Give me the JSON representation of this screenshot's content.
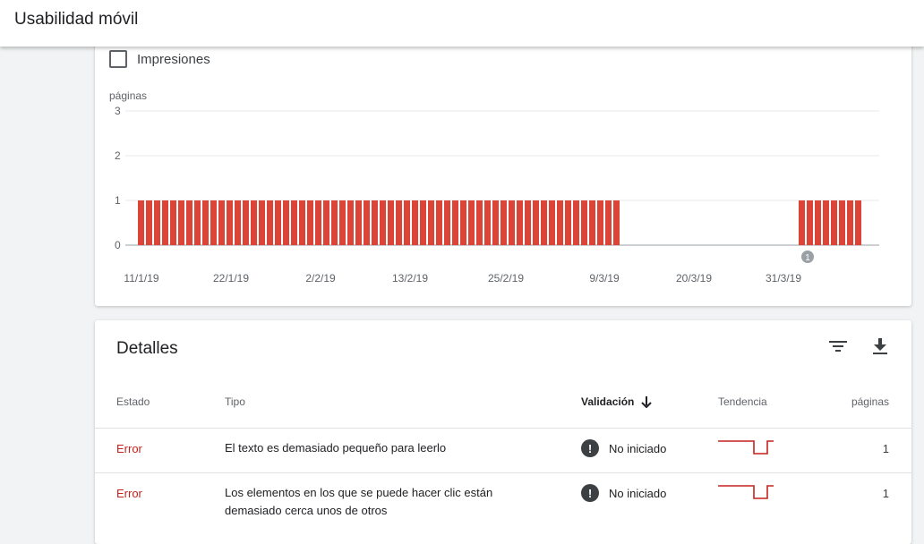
{
  "header": {
    "title": "Usabilidad móvil"
  },
  "chart_controls": {
    "impressions_label": "Impresiones"
  },
  "chart_data": {
    "type": "bar",
    "ylabel": "páginas",
    "ylim": [
      0,
      3
    ],
    "yticks": [
      "0",
      "1",
      "2",
      "3"
    ],
    "x_tick_labels": [
      "11/1/19",
      "22/1/19",
      "2/2/19",
      "13/2/19",
      "25/2/19",
      "9/3/19",
      "20/3/19",
      "31/3/19"
    ],
    "annotation": {
      "label": "1",
      "date": "1/4/19"
    },
    "bar_color": "#db4437",
    "series": [
      {
        "values": [
          1,
          1,
          1,
          1,
          1,
          1,
          1,
          1,
          1,
          1,
          1,
          1,
          1,
          1,
          1,
          1,
          1,
          1,
          1,
          1,
          1,
          1,
          1,
          1,
          1,
          1,
          1,
          1,
          1,
          1,
          1,
          1,
          1,
          1,
          1,
          1,
          1,
          1,
          1,
          1,
          1,
          1,
          1,
          1,
          1,
          1,
          1,
          1,
          1,
          1,
          1,
          1,
          1,
          1,
          1,
          1,
          1,
          1,
          1,
          1,
          0,
          0,
          0,
          0,
          0,
          0,
          0,
          0,
          0,
          0,
          0,
          0,
          0,
          0,
          0,
          0,
          0,
          0,
          0,
          0,
          0,
          0,
          1,
          1,
          1,
          1,
          1,
          1,
          1,
          1
        ]
      }
    ]
  },
  "details": {
    "title": "Detalles",
    "columns": {
      "estado": "Estado",
      "tipo": "Tipo",
      "validacion": "Validación",
      "tendencia": "Tendencia",
      "paginas": "páginas"
    },
    "rows": [
      {
        "estado": "Error",
        "tipo": "El texto es demasiado pequeño para leerlo",
        "validacion": "No iniciado",
        "paginas": "1"
      },
      {
        "estado": "Error",
        "tipo": "Los elementos en los que se puede hacer clic están demasiado cerca unos de otros",
        "validacion": "No iniciado",
        "paginas": "1"
      }
    ],
    "status_icon": "exclamation-icon",
    "accent": "#c5221f"
  }
}
